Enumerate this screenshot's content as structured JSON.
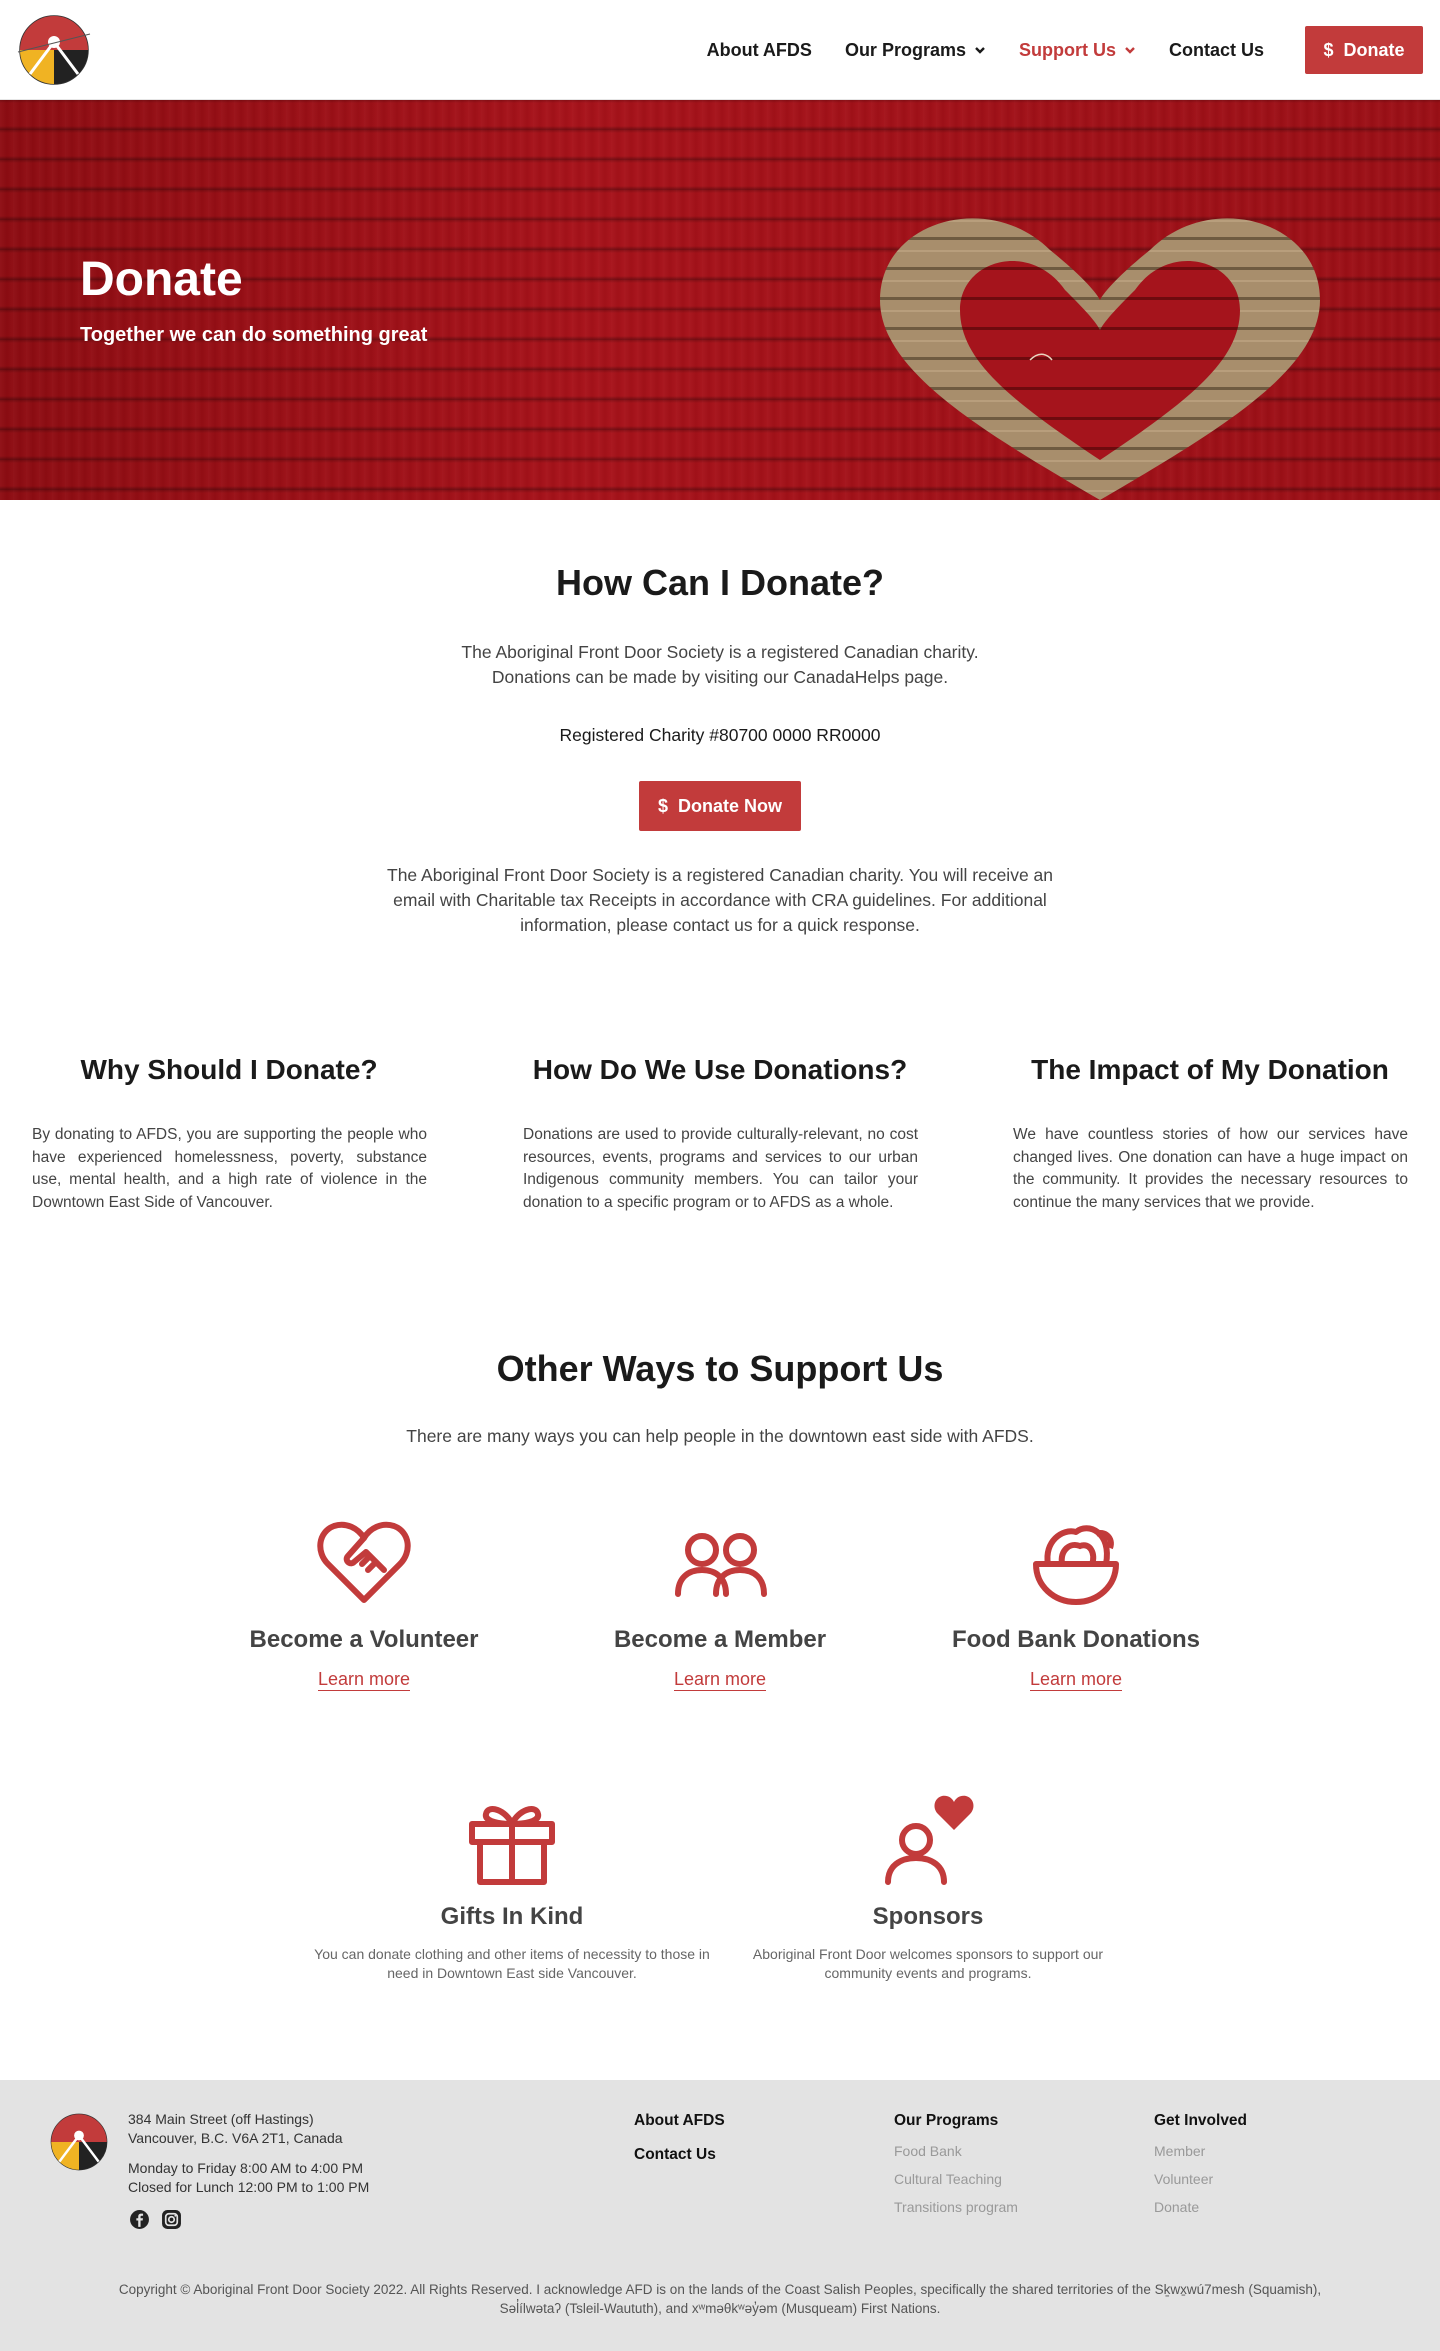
{
  "header": {
    "nav": {
      "about": "About AFDS",
      "programs": "Our Programs",
      "support": "Support Us",
      "contact": "Contact Us"
    },
    "donate_button": "Donate",
    "dollar": "$"
  },
  "hero": {
    "title": "Donate",
    "subtitle": "Together we can do something great"
  },
  "how_donate": {
    "title": "How Can I Donate?",
    "line1": "The Aboriginal Front Door Society is a registered Canadian charity.",
    "line2": "Donations can be made by visiting our CanadaHelps page.",
    "charity": "Registered Charity #80700 0000 RR0000",
    "button": "Donate Now",
    "note_line1": "The Aboriginal Front Door Society is a registered Canadian charity.  You will receive an",
    "note_line2": "email with Charitable tax Receipts in accordance with CRA guidelines. For additional",
    "note_line3": "information, please contact us for a quick response."
  },
  "columns": [
    {
      "title": "Why Should I Donate?",
      "text": "By donating to AFDS, you are supporting the people who have experienced homelessness, poverty, substance use, mental health, and a high rate of violence in the Downtown East Side of Vancouver."
    },
    {
      "title": "How Do We Use Donations?",
      "text": "Donations are used to provide culturally-relevant, no cost resources, events, programs and services to our urban Indigenous community members. You can tailor your donation to a specific program or to AFDS as a whole."
    },
    {
      "title": "The Impact of My Donation",
      "text": "We have countless stories of how our services have changed lives. One donation can have a huge impact on the community. It provides the necessary resources to continue the many services that we provide."
    }
  ],
  "other_ways": {
    "title": "Other Ways to Support Us",
    "subtitle": "There are many ways you can help people in the downtown east side with AFDS.",
    "cards": [
      {
        "title": "Become a Volunteer",
        "link": "Learn more",
        "icon": "heart-handshake-icon"
      },
      {
        "title": "Become a Member",
        "link": "Learn more",
        "icon": "users-icon"
      },
      {
        "title": "Food Bank Donations",
        "link": "Learn more",
        "icon": "food-bowl-icon"
      },
      {
        "title": "Gifts In Kind",
        "desc": "You can donate clothing and other items of necessity to those in need in Downtown East side Vancouver.",
        "icon": "gift-icon"
      },
      {
        "title": "Sponsors",
        "desc": "Aboriginal Front Door welcomes sponsors to support our community events and programs.",
        "icon": "user-heart-icon"
      }
    ]
  },
  "footer": {
    "address1": "384 Main Street (off Hastings)",
    "address2": "Vancouver, B.C. V6A 2T1, Canada",
    "hours1": "Monday to Friday 8:00 AM to 4:00 PM",
    "hours2": "Closed for Lunch 12:00 PM to 1:00 PM",
    "about": "About AFDS",
    "contact": "Contact Us",
    "programs_head": "Our Programs",
    "programs": [
      "Food Bank",
      "Cultural Teaching",
      "Transitions program"
    ],
    "involved_head": "Get Involved",
    "involved": [
      "Member",
      "Volunteer",
      "Donate"
    ],
    "copyright_line1": "Copyright © Aboriginal Front Door Society 2022. All Rights Reserved. I acknowledge AFD is on the lands of the Coast Salish Peoples, specifically the shared territories of the Sḵwx̱wú7mesh (Squamish),",
    "copyright_line2": "Səl̓ílwətaʔ (Tsleil-Waututh), and xʷməθkʷəy̓əm (Musqueam) First Nations."
  },
  "colors": {
    "accent": "#c23b3b",
    "footer_bg": "#e3e3e3"
  }
}
